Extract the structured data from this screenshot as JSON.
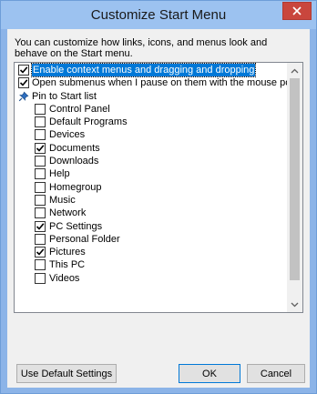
{
  "window": {
    "title": "Customize Start Menu",
    "accent_color": "#9cc2f0",
    "close_color": "#c9463d"
  },
  "description": "You can customize how links, icons, and menus look and behave on the Start menu.",
  "options": [
    {
      "label": "Enable context menus and dragging and dropping",
      "checked": true,
      "selected": true,
      "level": 0
    },
    {
      "label": "Open submenus when I pause on them with the mouse pointer",
      "checked": true,
      "selected": false,
      "level": 0
    }
  ],
  "pin_group": {
    "label": "Pin to Start list",
    "icon": "pin-icon",
    "items": [
      {
        "label": "Control Panel",
        "checked": false
      },
      {
        "label": "Default Programs",
        "checked": false
      },
      {
        "label": "Devices",
        "checked": false
      },
      {
        "label": "Documents",
        "checked": true
      },
      {
        "label": "Downloads",
        "checked": false
      },
      {
        "label": "Help",
        "checked": false
      },
      {
        "label": "Homegroup",
        "checked": false
      },
      {
        "label": "Music",
        "checked": false
      },
      {
        "label": "Network",
        "checked": false
      },
      {
        "label": "PC Settings",
        "checked": true
      },
      {
        "label": "Personal Folder",
        "checked": false
      },
      {
        "label": "Pictures",
        "checked": true
      },
      {
        "label": "This PC",
        "checked": false
      },
      {
        "label": "Videos",
        "checked": false
      }
    ]
  },
  "buttons": {
    "default_settings": "Use Default Settings",
    "ok": "OK",
    "cancel": "Cancel"
  }
}
